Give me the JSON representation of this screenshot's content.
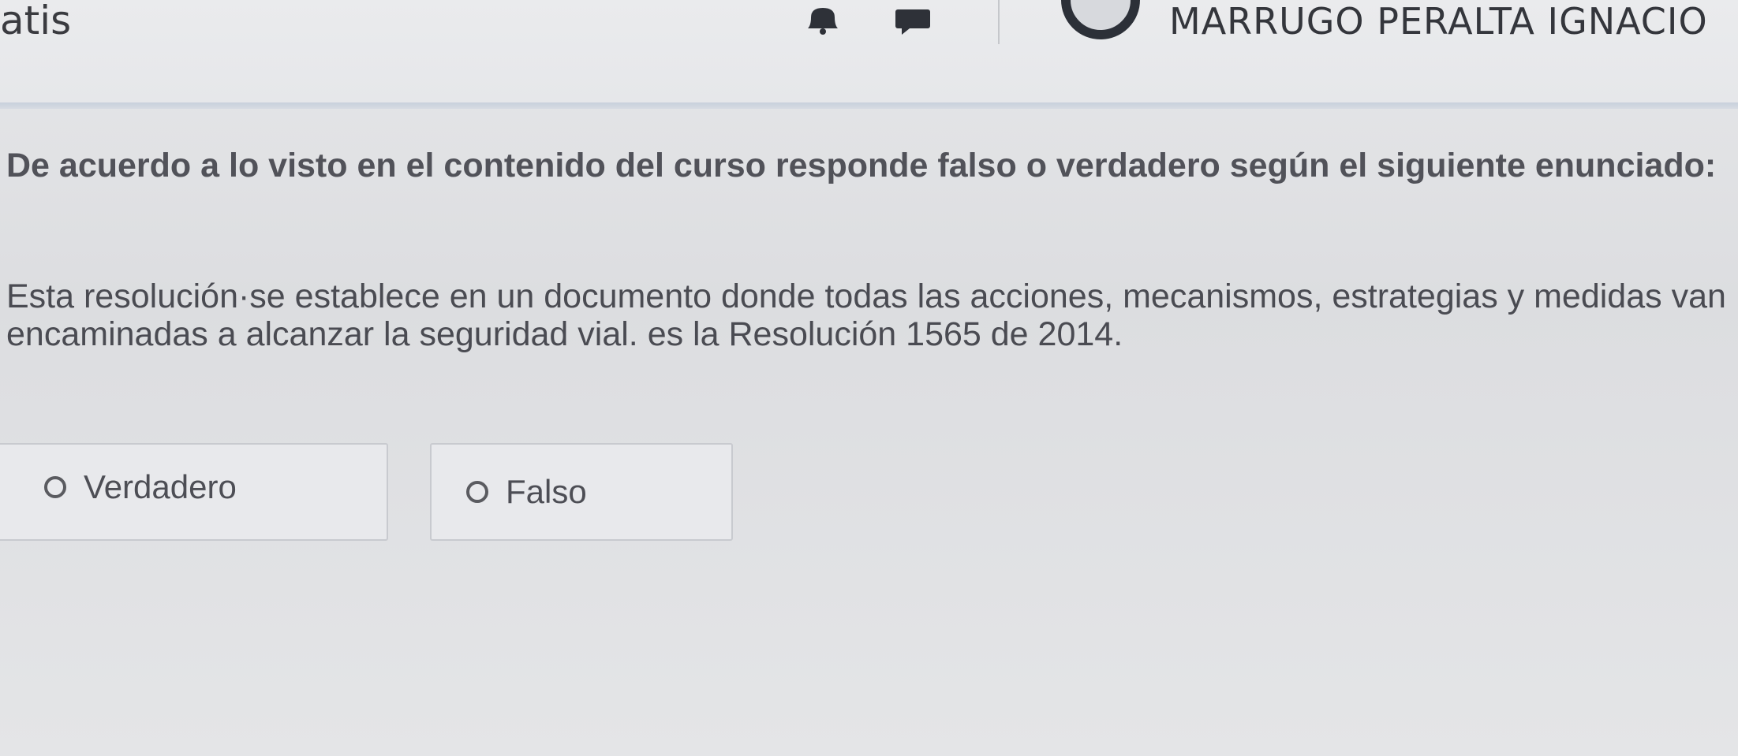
{
  "header": {
    "site_name": "atis",
    "notification_icon": "bell-icon",
    "messages_icon": "chat-bubble-icon",
    "user_avatar_icon": "user-avatar-icon",
    "user_name": "MARRUGO PERALTA IGNACIO"
  },
  "quiz": {
    "question": "De acuerdo a lo visto en el contenido del curso responde falso o verdadero según el siguiente enunciado:",
    "statement": "Esta resolución·se establece en un documento donde todas las acciones, mecanismos, estrategias y medidas van encaminadas a alcanzar la seguridad vial. es la Resolución 1565 de 2014.",
    "options": [
      {
        "label": "Verdadero",
        "selected": false
      },
      {
        "label": "Falso",
        "selected": false
      }
    ]
  },
  "colors": {
    "accent_line": "#c8d0dc",
    "text": "#4a4b52",
    "background": "#e0e1e4"
  }
}
